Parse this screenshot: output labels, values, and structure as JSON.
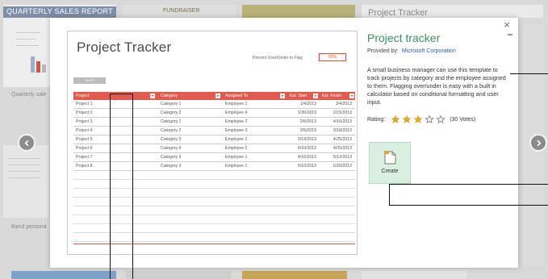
{
  "background": {
    "tile_left_title": "QUARTERLY SALES REPORT",
    "tile_mid_title": "FUNDRAISER",
    "right_title": "Project Tracker",
    "caption_1": "Quarterly sale",
    "caption_2": "Band persona"
  },
  "dialog": {
    "close_label": "×",
    "preview": {
      "title": "Project Tracker",
      "flag_label": "Percent Over/Under to Flag:",
      "flag_value": "55%",
      "sort_label": "SORT",
      "columns": [
        "Project",
        "Category",
        "Assigned To",
        "Est. Start",
        "Est. Finish"
      ],
      "rows": [
        [
          "Project 1",
          "Category 1",
          "Employee 1",
          "1/4/2013",
          "3/4/2013"
        ],
        [
          "Project 2",
          "Category 2",
          "Employee 4",
          "1/30/2013",
          "2/21/2013"
        ],
        [
          "Project 3",
          "Category 1",
          "Employee 2",
          "2/6/2013",
          "4/16/2013"
        ],
        [
          "Project 4",
          "Category 2",
          "Employee 3",
          "3/5/2013",
          "3/18/2013"
        ],
        [
          "Project 5",
          "Category 3",
          "Employee 2",
          "3/19/2013",
          "4/25/2013"
        ],
        [
          "Project 6",
          "Category 4",
          "Employee 2",
          "4/10/2013",
          "4/25/2013"
        ],
        [
          "Project 7",
          "Category 3",
          "Employee 1",
          "4/16/2013",
          "5/12/2013"
        ],
        [
          "Project 8",
          "Category 3",
          "Employee 1",
          "5/10/2013",
          "6/20/2013"
        ]
      ]
    },
    "info": {
      "title": "Project tracker",
      "provided_label": "Provided by:",
      "provider": "Microsoft Corporation",
      "description": "A small business manager can use this template to track projects by category and the employee assigned to them. Flagging over/under is easy with a built in calculator based on conditional formatting and user input.",
      "rating_label": "Rating:",
      "rating_stars": 3,
      "rating_max": 5,
      "votes": "(30 Votes)",
      "create_label": "Create"
    }
  },
  "colors": {
    "accent_green": "#3f8f63",
    "header_red": "#e05a4e",
    "star_gold": "#e0a42a",
    "link_blue": "#2b5fa5"
  }
}
